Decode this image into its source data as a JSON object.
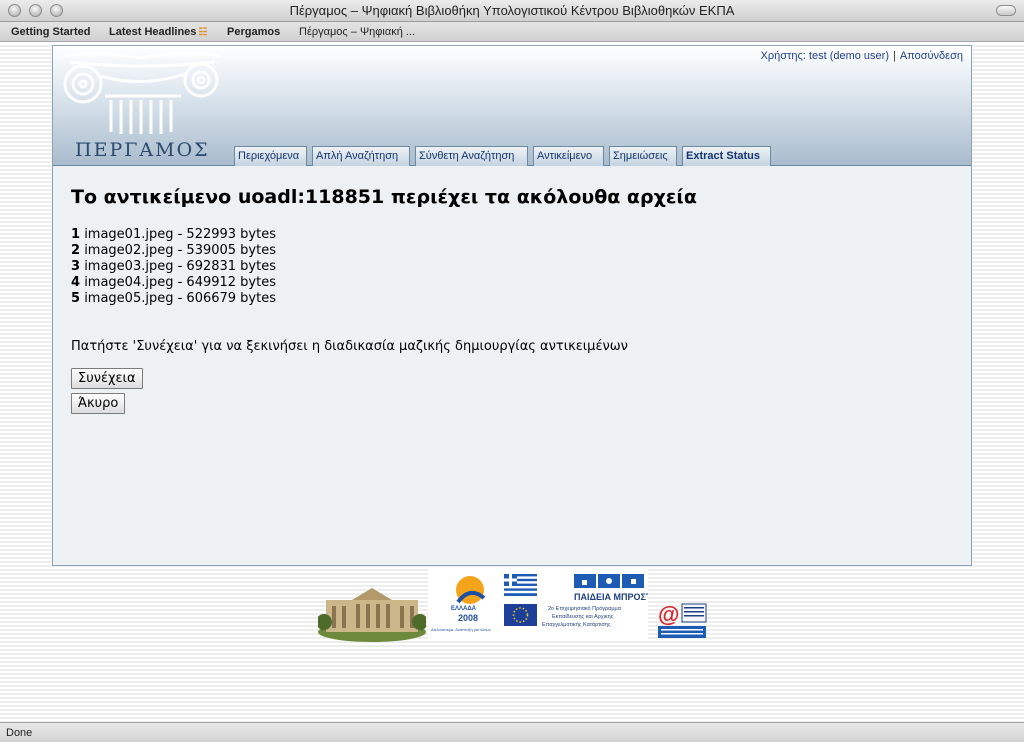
{
  "window": {
    "title": "Πέργαμος – Ψηφιακή Βιβλιοθήκη Υπολογιστικού Κέντρου Βιβλιοθηκών ΕΚΠΑ"
  },
  "bookmarks": [
    {
      "label": "Getting Started"
    },
    {
      "label": "Latest Headlines"
    },
    {
      "label": "Pergamos"
    },
    {
      "label": "Πέργαμος – Ψηφιακή ..."
    }
  ],
  "header": {
    "logo_text": "ΠΕΡΓΑΜΟΣ",
    "user_label": "Χρήστης: test (demo user)",
    "logout_label": "Αποσύνδεση"
  },
  "tabs": [
    {
      "label": "Περιεχόμενα"
    },
    {
      "label": "Απλή Αναζήτηση"
    },
    {
      "label": "Σύνθετη Αναζήτηση"
    },
    {
      "label": "Αντικείμενο"
    },
    {
      "label": "Σημειώσεις"
    },
    {
      "label": "Extract Status"
    }
  ],
  "main": {
    "heading_prefix": "Το αντικείμενο",
    "object_id": "uoadl:118851",
    "heading_suffix": "περιέχει τα ακόλουθα αρχεία",
    "files": [
      {
        "num": "1",
        "name": "image01.jpeg - 522993 bytes"
      },
      {
        "num": "2",
        "name": "image02.jpeg - 539005 bytes"
      },
      {
        "num": "3",
        "name": "image03.jpeg - 692831 bytes"
      },
      {
        "num": "4",
        "name": "image04.jpeg - 649912 bytes"
      },
      {
        "num": "5",
        "name": "image05.jpeg - 606679 bytes"
      }
    ],
    "instruction": "Πατήστε 'Συνέχεια' για να ξεκινήσει η διαδικασία μαζικής δημιουργίας αντικειμένων",
    "continue_label": "Συνέχεια",
    "cancel_label": "Άκυρο"
  },
  "footer": {
    "ellada_text": "ΕΛΛΑΔΑ",
    "ellada_year": "2008",
    "ellada_motto": "Απλούστεμα. Ανάπτυξη για όλους.",
    "paideia_title": "ΠΑΙΔΕΙΑ ΜΠΡΟΣΤΑ",
    "paideia_line1": "2ο Επιχειρησιακό Πρόγραμμα",
    "paideia_line2": "Εκπαίδευσης και Αρχικής",
    "paideia_line3": "Επαγγελματικής Κατάρτισης",
    "at_symbol": "@"
  },
  "status": {
    "text": "Done"
  },
  "colors": {
    "link": "#1f3f8f",
    "tab_text": "#14356e",
    "panel_border": "#8ea2b5"
  },
  "icons": {
    "rss": "rss-icon"
  }
}
